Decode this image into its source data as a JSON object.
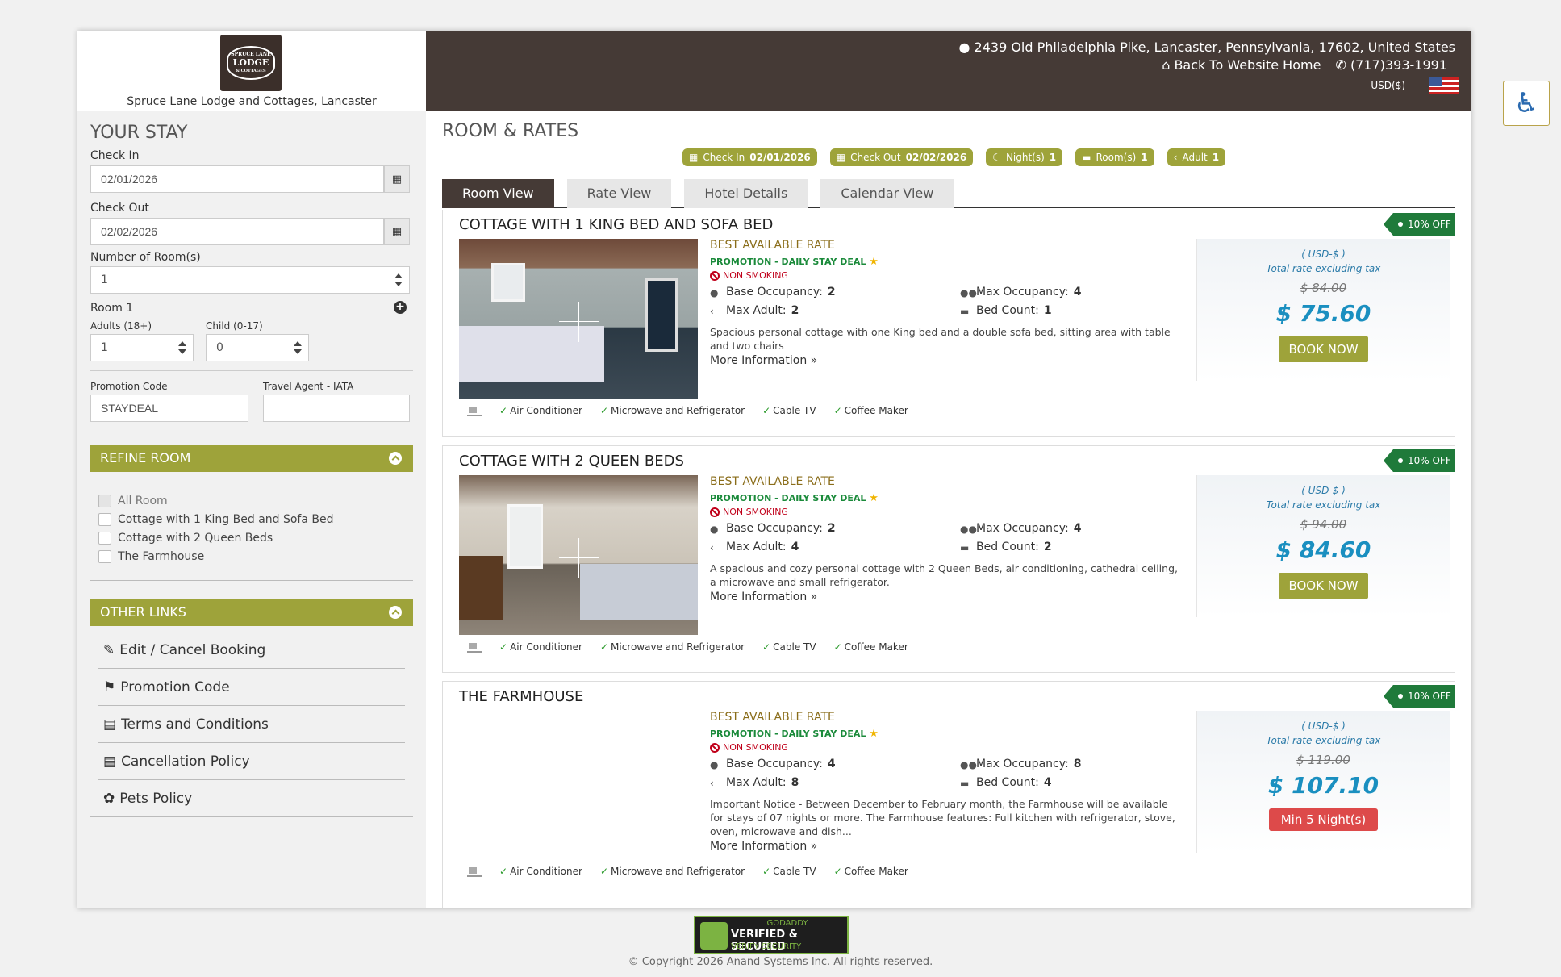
{
  "header": {
    "hotel_name": "Spruce Lane Lodge and Cottages, Lancaster",
    "logo_text": [
      "SPRUCE LANE",
      "LODGE",
      "& COTTAGES"
    ],
    "address": "2439 Old Philadelphia Pike, Lancaster, Pennsylvania, 17602, United States",
    "back_home": "Back To Website Home",
    "phone": "(717)393-1991",
    "currency": "USD($)"
  },
  "sidebar": {
    "title": "YOUR STAY",
    "check_in_label": "Check In",
    "check_in_value": "02/01/2026",
    "check_out_label": "Check Out",
    "check_out_value": "02/02/2026",
    "rooms_label": "Number of Room(s)",
    "rooms_value": "1",
    "room_title": "Room 1",
    "adults_label": "Adults (18+)",
    "adults_value": "1",
    "child_label": "Child (0-17)",
    "child_value": "0",
    "promo_label": "Promotion Code",
    "promo_value": "STAYDEAL",
    "agent_label": "Travel Agent - IATA",
    "agent_value": "",
    "refine_title": "REFINE ROOM",
    "refine_items": [
      "All Room",
      "Cottage with 1 King Bed and Sofa Bed",
      "Cottage with 2 Queen Beds",
      "The Farmhouse"
    ],
    "other_links_title": "OTHER LINKS",
    "other_links": [
      "Edit / Cancel Booking",
      "Promotion Code",
      "Terms and Conditions",
      "Cancellation Policy",
      "Pets Policy"
    ]
  },
  "main": {
    "title": "ROOM & RATES",
    "badges": [
      {
        "label": "Check In",
        "value": "02/01/2026"
      },
      {
        "label": "Check Out",
        "value": "02/02/2026"
      },
      {
        "label": "Night(s)",
        "value": "1"
      },
      {
        "label": "Room(s)",
        "value": "1"
      },
      {
        "label": "Adult",
        "value": "1"
      }
    ],
    "tabs": [
      "Room View",
      "Rate View",
      "Hotel Details",
      "Calendar View"
    ],
    "active_tab": "Room View"
  },
  "rooms": [
    {
      "name": "COTTAGE WITH 1 KING BED AND SOFA BED",
      "discount": "10% OFF",
      "rate_name": "BEST AVAILABLE RATE",
      "promo": "PROMOTION - DAILY STAY DEAL",
      "smoking": "NON SMOKING",
      "base_occ_label": "Base Occupancy:",
      "base_occ": "2",
      "max_occ_label": "Max Occupancy:",
      "max_occ": "4",
      "max_adult_label": "Max Adult:",
      "max_adult": "2",
      "bed_count_label": "Bed Count:",
      "bed_count": "1",
      "description": "Spacious personal cottage with one King bed and a double sofa bed, sitting area with table and two chairs",
      "more_info": "More Information",
      "amenities": [
        "Air Conditioner",
        "Microwave and Refrigerator",
        "Cable TV",
        "Coffee Maker"
      ],
      "currency": "( USD-$ )",
      "tax_note": "Total rate excluding tax",
      "old_price": "$ 84.00",
      "new_price": "$ 75.60",
      "action": "BOOK NOW"
    },
    {
      "name": "COTTAGE WITH 2 QUEEN BEDS",
      "discount": "10% OFF",
      "rate_name": "BEST AVAILABLE RATE",
      "promo": "PROMOTION - DAILY STAY DEAL",
      "smoking": "NON SMOKING",
      "base_occ_label": "Base Occupancy:",
      "base_occ": "2",
      "max_occ_label": "Max Occupancy:",
      "max_occ": "4",
      "max_adult_label": "Max Adult:",
      "max_adult": "4",
      "bed_count_label": "Bed Count:",
      "bed_count": "2",
      "description": "A spacious and cozy personal cottage with 2 Queen Beds, air conditioning, cathedral ceiling, a microwave and small refrigerator.",
      "more_info": "More Information",
      "amenities": [
        "Air Conditioner",
        "Microwave and Refrigerator",
        "Cable TV",
        "Coffee Maker"
      ],
      "currency": "( USD-$ )",
      "tax_note": "Total rate excluding tax",
      "old_price": "$ 94.00",
      "new_price": "$ 84.60",
      "action": "BOOK NOW"
    },
    {
      "name": "THE FARMHOUSE",
      "discount": "10% OFF",
      "rate_name": "BEST AVAILABLE RATE",
      "promo": "PROMOTION - DAILY STAY DEAL",
      "smoking": "NON SMOKING",
      "base_occ_label": "Base Occupancy:",
      "base_occ": "4",
      "max_occ_label": "Max Occupancy:",
      "max_occ": "8",
      "max_adult_label": "Max Adult:",
      "max_adult": "8",
      "bed_count_label": "Bed Count:",
      "bed_count": "4",
      "description": "Important Notice - Between December to February month, the Farmhouse will be available for stays of 07 nights or more. The Farmhouse features: Full kitchen with refrigerator, stove, oven, microwave and dish...",
      "more_info": "More Information",
      "amenities": [
        "Air Conditioner",
        "Microwave and Refrigerator",
        "Cable TV",
        "Coffee Maker"
      ],
      "currency": "( USD-$ )",
      "tax_note": "Total rate excluding tax",
      "old_price": "$ 119.00",
      "new_price": "$ 107.10",
      "action": "Min 5 Night(s)"
    }
  ],
  "footer": {
    "secure_top": "GODADDY",
    "secure_main": "VERIFIED & SECURED",
    "secure_sub": "VERIFY SECURITY",
    "copyright": "© Copyright 2026 Anand Systems Inc. All rights reserved."
  }
}
